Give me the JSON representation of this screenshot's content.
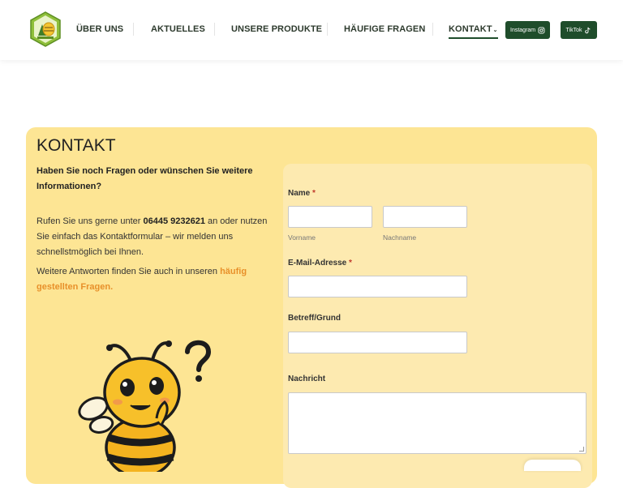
{
  "header": {
    "nav": [
      {
        "label": "ÜBER UNS"
      },
      {
        "label": "AKTUELLES"
      },
      {
        "label": "UNSERE PRODUKTE"
      },
      {
        "label": "HÄUFIGE FRAGEN"
      },
      {
        "label": "KONTAKT"
      }
    ],
    "social": [
      {
        "label": "Instagram",
        "icon": "instagram-icon"
      },
      {
        "label": "TikTok",
        "icon": "tiktok-icon"
      }
    ]
  },
  "main": {
    "title": "KONTAKT",
    "intro_bold": "Haben Sie noch Fragen oder wünschen Sie weitere Informationen?",
    "intro_pre": "Rufen Sie uns gerne unter ",
    "phone": "06445 9232621",
    "intro_post": " an oder nutzen Sie einfach das Kontaktformular – wir melden uns schnellstmöglich bei Ihnen.",
    "faq_pre": "Weitere Antworten finden Sie auch in unseren ",
    "faq_link": "häufig gestellten Fragen",
    "faq_post": "."
  },
  "form": {
    "name_label": "Name",
    "required_mark": "*",
    "first_name_sub": "Vorname",
    "last_name_sub": "Nachname",
    "first_name_value": "",
    "last_name_value": "",
    "email_label": "E-Mail-Adresse",
    "email_value": "",
    "subject_label": "Betreff/Grund",
    "subject_value": "",
    "message_label": "Nachricht",
    "message_value": ""
  },
  "colors": {
    "brand_green": "#1f4d2b",
    "card_yellow": "#fde594",
    "link_orange": "#e8902a"
  }
}
